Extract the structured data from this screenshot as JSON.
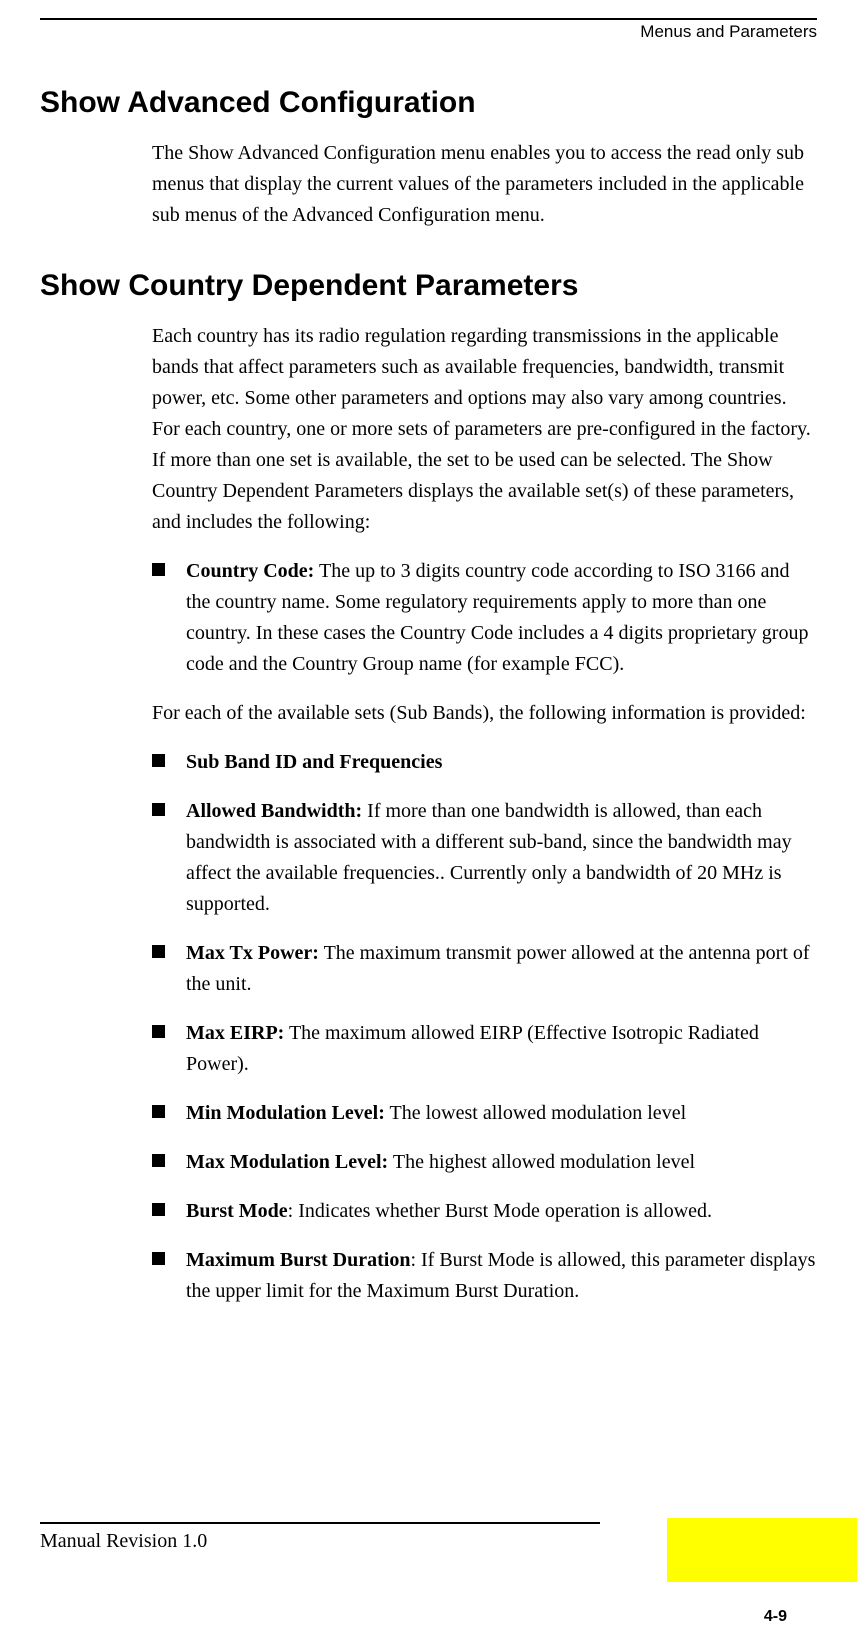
{
  "header": {
    "section": "Menus and Parameters"
  },
  "h1a": "Show Advanced Configuration",
  "p1": "The Show Advanced Configuration menu enables you to access the read only sub menus that display the current values of the parameters included in the applicable sub menus of the Advanced Configuration menu.",
  "h1b": "Show Country Dependent Parameters",
  "p2": "Each country has its radio regulation regarding transmissions in the applicable bands that affect parameters such as available frequencies, bandwidth, transmit power, etc. Some other parameters and options may also vary among countries. For each country, one or more sets of parameters are pre-configured in the factory. If more than one set is available, the set to be used can be selected. The Show Country Dependent Parameters displays the available set(s) of these parameters, and includes the following:",
  "bullets1": [
    {
      "label": "Country Code:",
      "text": " The up to 3 digits country code according to ISO 3166 and the country name. Some regulatory requirements apply to more than one country. In these cases the Country Code includes a 4 digits proprietary group code and the Country Group name (for example FCC)."
    }
  ],
  "p3": "For each of the available sets (Sub Bands), the following information is provided:",
  "bullets2": [
    {
      "label": "Sub Band ID and Frequencies",
      "text": ""
    },
    {
      "label": "Allowed Bandwidth:",
      "text": " If more than one bandwidth is allowed, than each bandwidth is associated with a different sub-band, since the bandwidth may affect the available frequencies.. Currently only a bandwidth of 20 MHz is supported."
    },
    {
      "label": "Max Tx Power:",
      "text": " The maximum transmit power allowed at the antenna port of the unit."
    },
    {
      "label": "Max EIRP:",
      "text": " The maximum allowed EIRP (Effective Isotropic Radiated Power)."
    },
    {
      "label": "Min Modulation Level:",
      "text": " The lowest allowed modulation level"
    },
    {
      "label": "Max Modulation Level:",
      "text": " The highest allowed modulation level"
    },
    {
      "label": "Burst Mode",
      "text": ": Indicates whether Burst Mode operation is allowed."
    },
    {
      "label": "Maximum Burst Duration",
      "text": ": If Burst Mode is allowed, this parameter displays the upper limit for the Maximum Burst Duration."
    }
  ],
  "footer": {
    "left": "Manual Revision 1.0",
    "page": "4-9"
  }
}
